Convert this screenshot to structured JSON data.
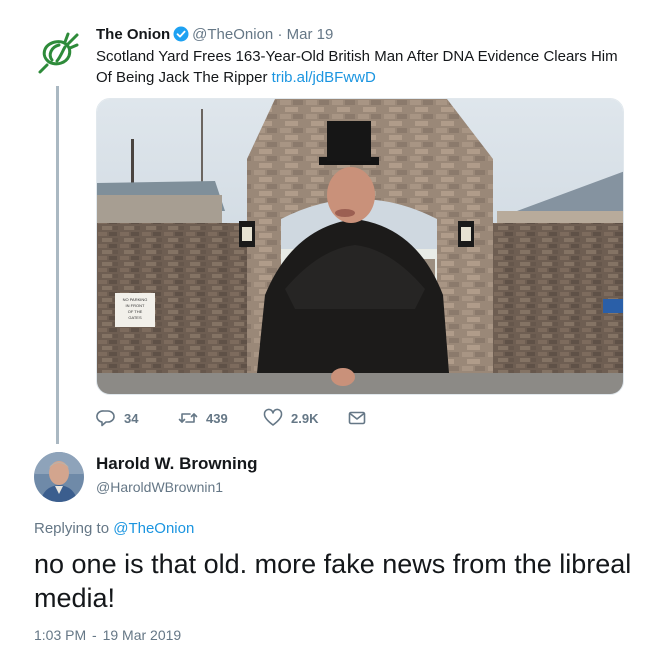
{
  "original_tweet": {
    "author_name": "The Onion",
    "handle": "@TheOnion",
    "separator": "·",
    "date": "Mar 19",
    "text": "Scotland Yard Frees 163-Year-Old British Man After DNA Evidence Clears Him Of Being Jack The Ripper",
    "link": "trib.al/jdBFwwD",
    "media": {
      "sign_text": [
        "NO PARKING",
        "IN FRONT",
        "OF THE",
        "GATES"
      ]
    },
    "actions": {
      "replies": "34",
      "retweets": "439",
      "likes": "2.9K"
    }
  },
  "reply": {
    "author_name": "Harold W. Browning",
    "handle": "@HaroldWBrownin1",
    "replying_prefix": "Replying to",
    "replying_to": "@TheOnion",
    "text": "no one is that old. more fake news from the libreal media!",
    "time": "1:03 PM",
    "separator": "-",
    "date": "19 Mar 2019"
  },
  "colors": {
    "brand_green": "#2e8b3a",
    "link_blue": "#1b95e0",
    "secondary_text": "#657786",
    "thread_line": "#aab8c2"
  },
  "icons": {
    "onion_logo": "onion-logo-icon",
    "verified": "verified-badge-icon",
    "reply": "reply-icon",
    "retweet": "retweet-icon",
    "like": "heart-icon",
    "dm": "envelope-icon"
  }
}
